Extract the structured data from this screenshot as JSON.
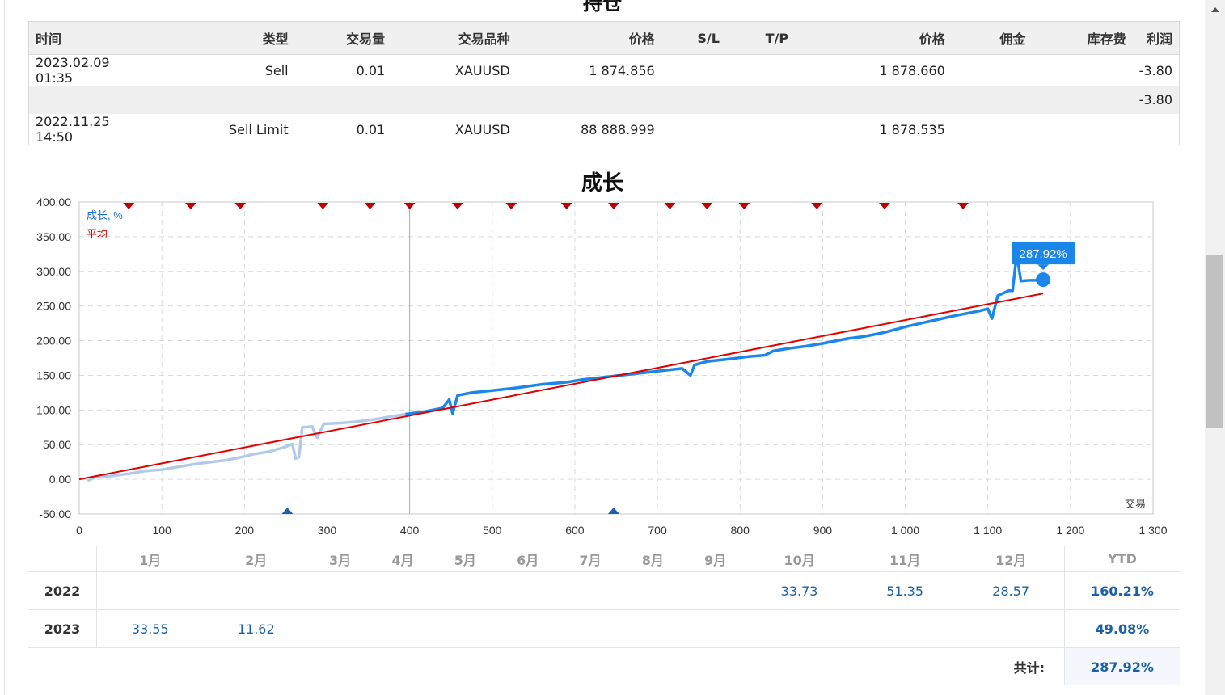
{
  "positions": {
    "title": "持仓",
    "headers": [
      "时间",
      "类型",
      "交易量",
      "交易品种",
      "价格",
      "S/L",
      "T/P",
      "价格",
      "佣金",
      "库存费",
      "利润"
    ],
    "rows": [
      {
        "time": "2023.02.09 01:35",
        "type": "Sell",
        "volume": "0.01",
        "symbol": "XAUUSD",
        "price": "1 874.856",
        "sl": "",
        "tp": "",
        "price2": "1 878.660",
        "commission": "",
        "swap": "",
        "profit": "-3.80"
      },
      {
        "time": "",
        "type": "",
        "volume": "",
        "symbol": "",
        "price": "",
        "sl": "",
        "tp": "",
        "price2": "",
        "commission": "",
        "swap": "",
        "profit": "-3.80"
      },
      {
        "time": "2022.11.25 14:50",
        "type": "Sell Limit",
        "volume": "0.01",
        "symbol": "XAUUSD",
        "price": "88 888.999",
        "sl": "",
        "tp": "",
        "price2": "1 878.535",
        "commission": "",
        "swap": "",
        "profit": ""
      }
    ]
  },
  "growth": {
    "title": "成长",
    "legend_growth": "成长, %",
    "legend_avg": "平均",
    "xaxis_label": "交易",
    "tooltip": "287.92%"
  },
  "chart_data": {
    "type": "line",
    "title": "成长",
    "xlabel": "交易",
    "ylabel": "",
    "xlim": [
      0,
      1300
    ],
    "ylim": [
      -50,
      400
    ],
    "x_ticks": [
      "0",
      "100",
      "200",
      "300",
      "400",
      "500",
      "600",
      "700",
      "800",
      "900",
      "1 000",
      "1 100",
      "1 200",
      "1 300"
    ],
    "y_ticks": [
      "-50.00",
      "0.00",
      "50.00",
      "100.00",
      "150.00",
      "200.00",
      "250.00",
      "300.00",
      "350.00",
      "400.00"
    ],
    "grid": true,
    "legend_position": "top-left",
    "series": [
      {
        "name": "成长, %",
        "color_past": "#b0cbea",
        "color": "#1a86ea",
        "split_x": 400,
        "points": [
          [
            10,
            -2
          ],
          [
            20,
            3
          ],
          [
            40,
            5
          ],
          [
            60,
            8
          ],
          [
            80,
            12
          ],
          [
            100,
            14
          ],
          [
            120,
            18
          ],
          [
            140,
            22
          ],
          [
            160,
            25
          ],
          [
            180,
            28
          ],
          [
            200,
            33
          ],
          [
            210,
            36
          ],
          [
            230,
            40
          ],
          [
            250,
            47
          ],
          [
            258,
            51
          ],
          [
            262,
            30
          ],
          [
            266,
            32
          ],
          [
            270,
            75
          ],
          [
            282,
            76
          ],
          [
            288,
            60
          ],
          [
            296,
            80
          ],
          [
            315,
            81
          ],
          [
            335,
            83
          ],
          [
            355,
            86
          ],
          [
            375,
            90
          ],
          [
            395,
            94
          ],
          [
            420,
            98
          ],
          [
            440,
            103
          ],
          [
            448,
            115
          ],
          [
            452,
            95
          ],
          [
            458,
            121
          ],
          [
            475,
            125
          ],
          [
            500,
            128
          ],
          [
            530,
            132
          ],
          [
            560,
            137
          ],
          [
            590,
            140
          ],
          [
            610,
            144
          ],
          [
            640,
            148
          ],
          [
            670,
            152
          ],
          [
            700,
            156
          ],
          [
            730,
            160
          ],
          [
            740,
            150
          ],
          [
            745,
            165
          ],
          [
            760,
            170
          ],
          [
            790,
            174
          ],
          [
            810,
            177
          ],
          [
            830,
            179
          ],
          [
            840,
            185
          ],
          [
            860,
            189
          ],
          [
            880,
            192
          ],
          [
            900,
            196
          ],
          [
            930,
            203
          ],
          [
            950,
            206
          ],
          [
            975,
            212
          ],
          [
            1000,
            220
          ],
          [
            1030,
            228
          ],
          [
            1060,
            236
          ],
          [
            1090,
            243
          ],
          [
            1100,
            246
          ],
          [
            1105,
            232
          ],
          [
            1112,
            265
          ],
          [
            1125,
            272
          ],
          [
            1130,
            272
          ],
          [
            1135,
            325
          ],
          [
            1140,
            286
          ],
          [
            1150,
            287
          ],
          [
            1160,
            287
          ],
          [
            1167,
            288
          ]
        ]
      },
      {
        "name": "平均",
        "color": "#e00000",
        "points": [
          [
            0,
            0
          ],
          [
            1167,
            268
          ]
        ]
      }
    ],
    "deposit_markers_x": [
      60,
      135,
      195,
      295,
      352,
      400,
      458,
      523,
      590,
      647,
      715,
      760,
      805,
      893,
      975,
      1070
    ],
    "withdraw_markers_x": [
      252,
      647
    ],
    "last_value": 287.92
  },
  "monthly": {
    "months": [
      "1月",
      "2月",
      "3月",
      "4月",
      "5月",
      "6月",
      "7月",
      "8月",
      "9月",
      "10月",
      "11月",
      "12月"
    ],
    "ytd_label": "YTD",
    "rows": [
      {
        "year": "2022",
        "values": [
          "",
          "",
          "",
          "",
          "",
          "",
          "",
          "",
          "",
          "33.73",
          "51.35",
          "28.57"
        ],
        "ytd": "160.21%"
      },
      {
        "year": "2023",
        "values": [
          "33.55",
          "11.62",
          "",
          "",
          "",
          "",
          "",
          "",
          "",
          "",
          "",
          ""
        ],
        "ytd": "49.08%"
      }
    ],
    "total_label": "共计:",
    "total_value": "287.92%"
  }
}
